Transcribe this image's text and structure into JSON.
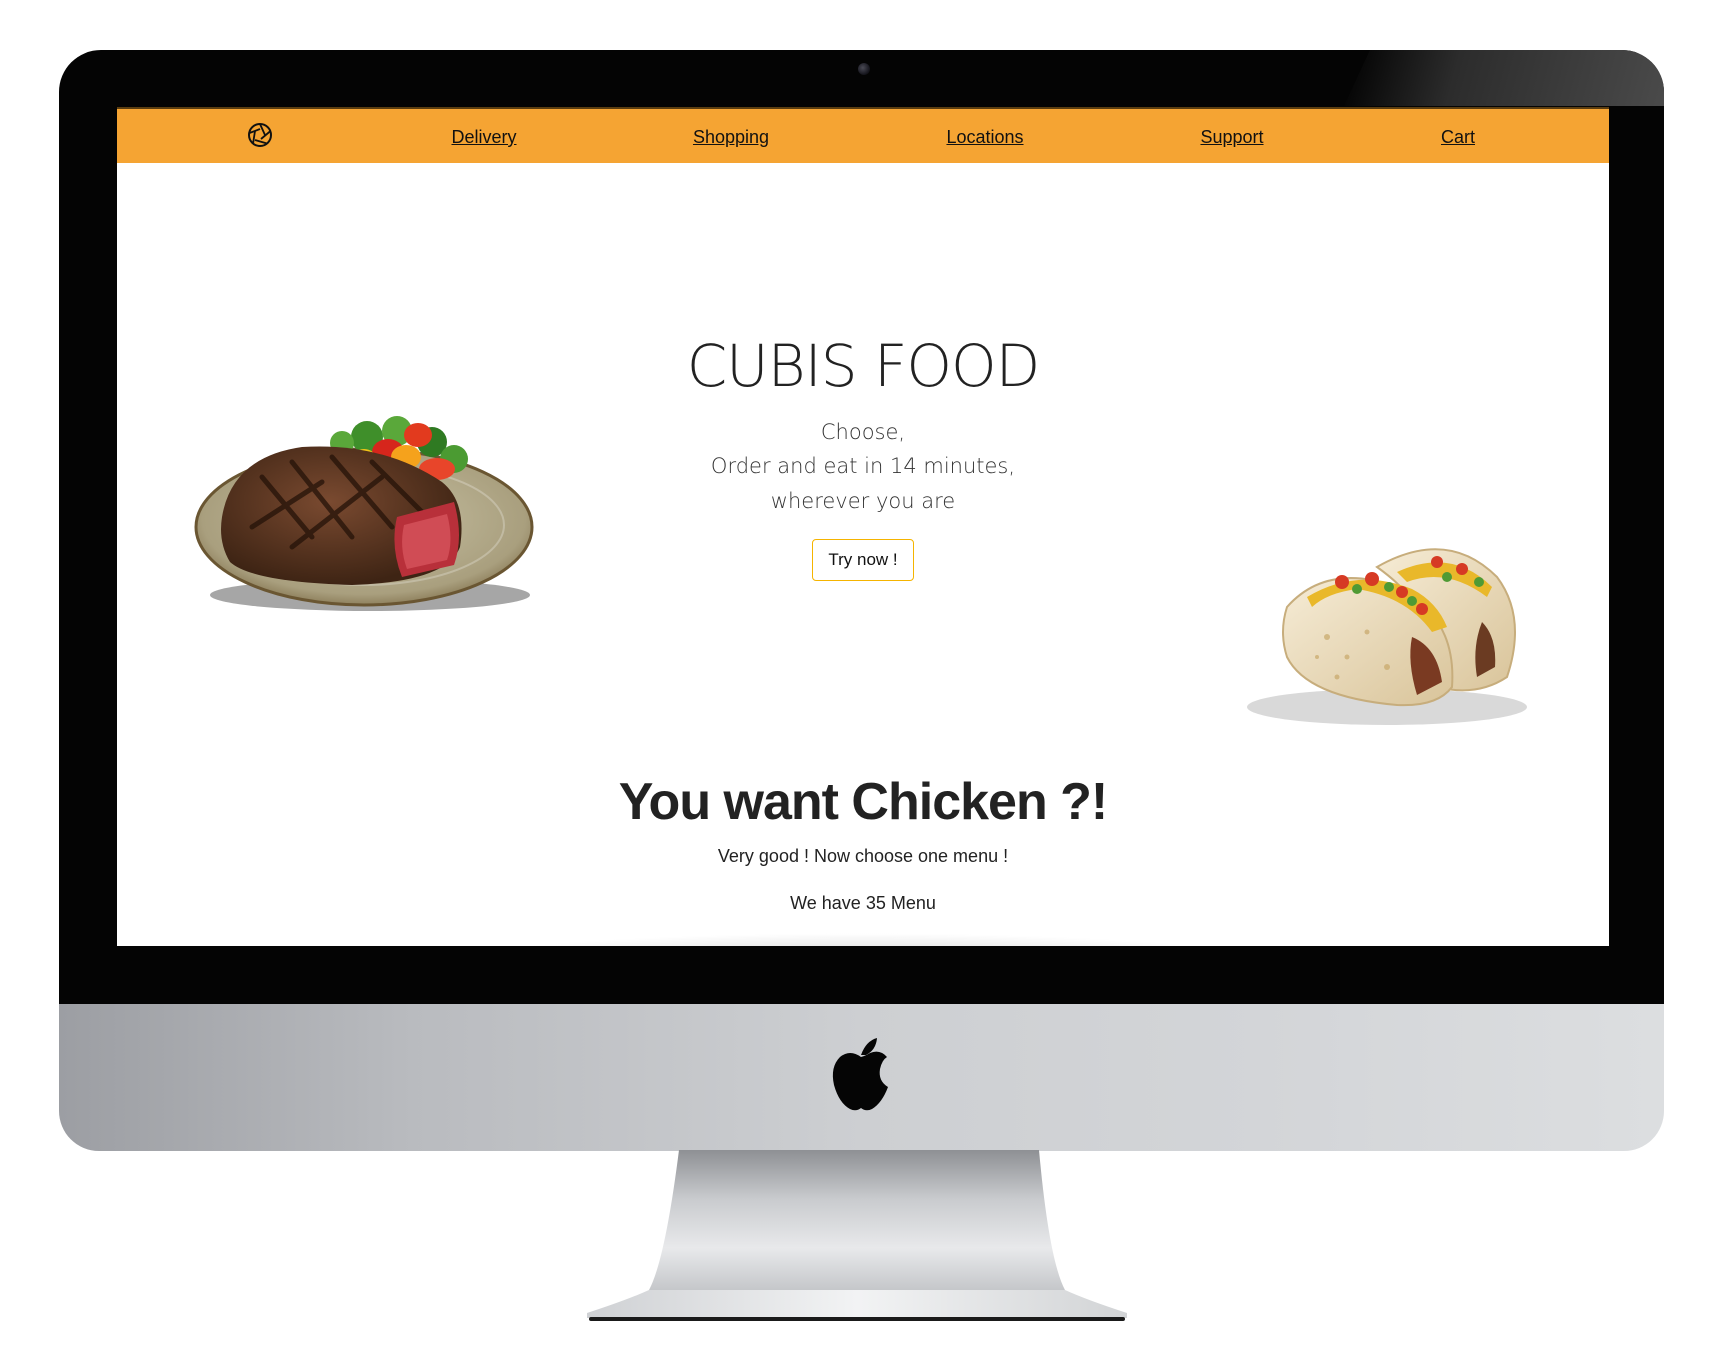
{
  "colors": {
    "navbar_bg": "#f5a433",
    "button_border": "#f5b400",
    "text": "#222222",
    "bezel": "#040404"
  },
  "device": {
    "logo_icon": "apple-logo-icon",
    "camera_icon": "camera-icon"
  },
  "nav": {
    "logo_icon": "aperture-icon",
    "links": [
      "Delivery",
      "Shopping",
      "Locations",
      "Support",
      "Cart"
    ]
  },
  "hero": {
    "title": "CUBIS FOOD",
    "lines": [
      "Choose,",
      "Order and eat in 14 minutes,",
      "wherever you are"
    ],
    "cta_label": "Try now !",
    "images": [
      "steak-plate-image",
      "tacos-image"
    ]
  },
  "section": {
    "title": "You want Chicken ?!",
    "subtitle": "Very good ! Now choose one menu !",
    "count_text": "We have 35 Menu"
  }
}
